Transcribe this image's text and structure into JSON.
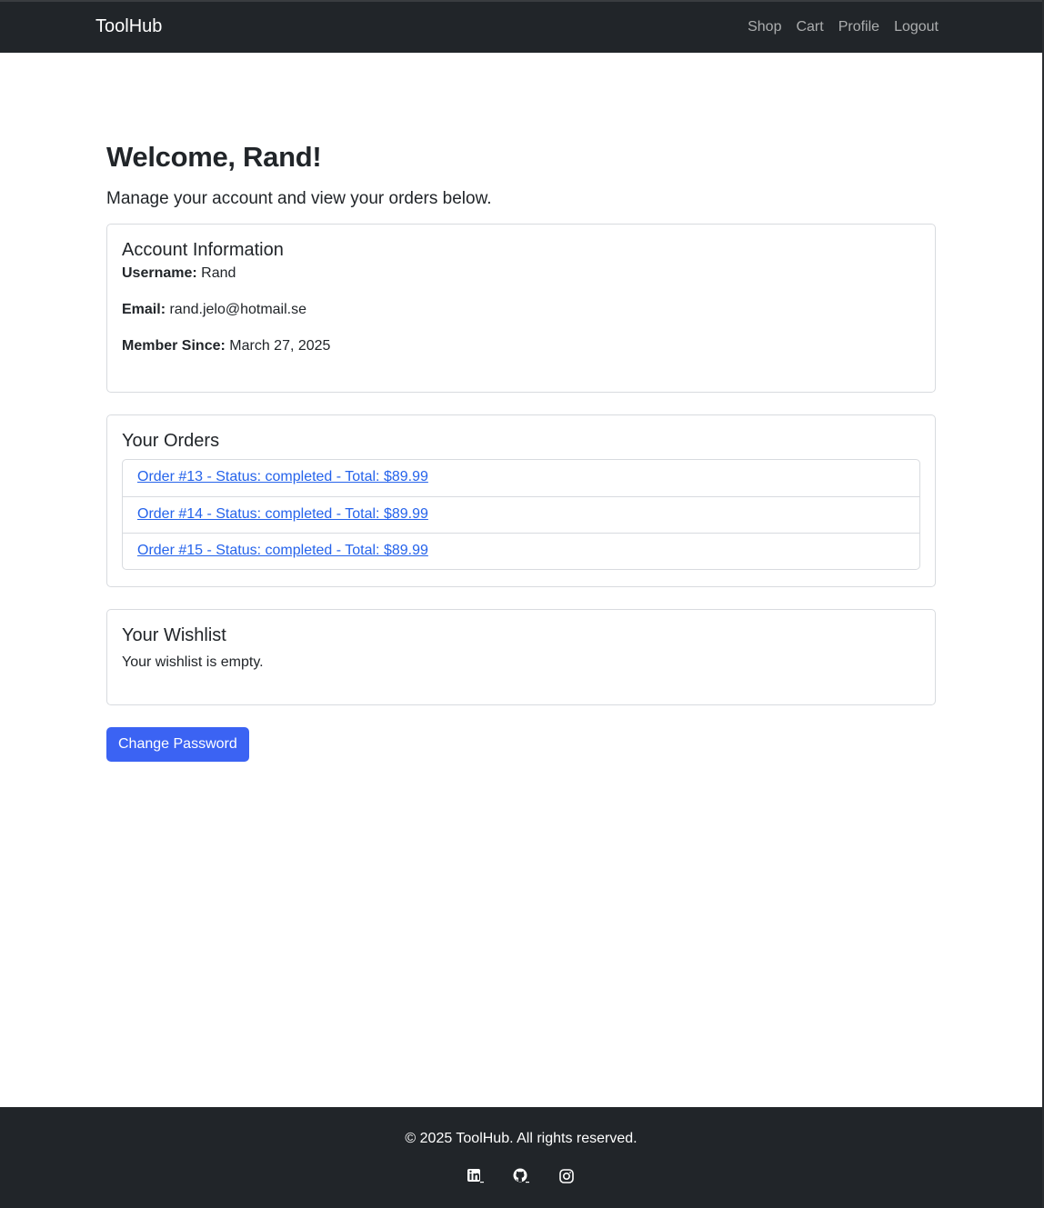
{
  "navbar": {
    "brand": "ToolHub",
    "links": [
      "Shop",
      "Cart",
      "Profile",
      "Logout"
    ]
  },
  "page": {
    "title": "Welcome, Rand!",
    "lead": "Manage your account and view your orders below."
  },
  "account": {
    "title": "Account Information",
    "username_label": "Username:",
    "username": "Rand",
    "email_label": "Email:",
    "email": "rand.jelo@hotmail.se",
    "member_since_label": "Member Since:",
    "member_since": "March 27, 2025"
  },
  "orders": {
    "title": "Your Orders",
    "items": [
      "Order #13 - Status: completed - Total: $89.99",
      "Order #14 - Status: completed - Total: $89.99",
      "Order #15 - Status: completed - Total: $89.99"
    ]
  },
  "wishlist": {
    "title": "Your Wishlist",
    "empty_text": "Your wishlist is empty."
  },
  "change_password_label": "Change Password",
  "footer": {
    "copyright": "© 2025 ToolHub. All rights reserved.",
    "icons": [
      "linkedin-icon",
      "github-icon",
      "instagram-icon"
    ]
  },
  "colors": {
    "navbar_bg": "#212529",
    "link": "#2563eb",
    "button_bg": "#3b63f3"
  }
}
